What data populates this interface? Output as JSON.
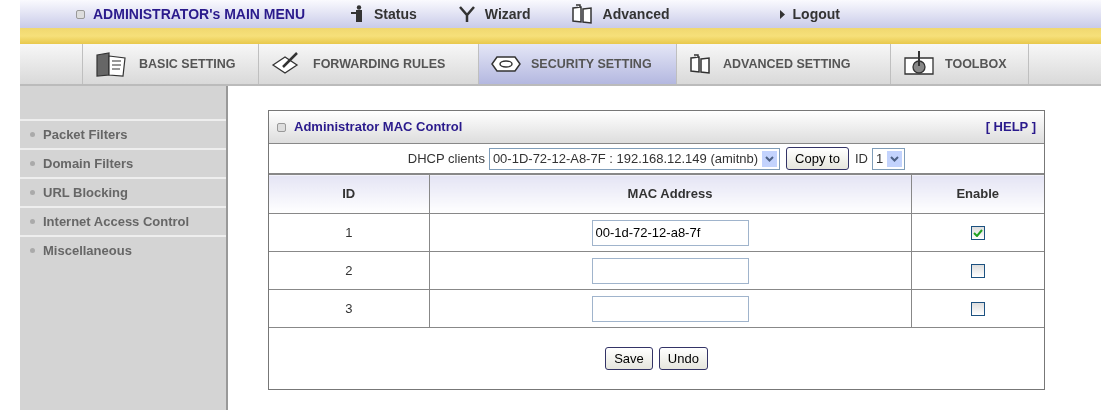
{
  "main_menu": {
    "title": "ADMINISTRATOR's MAIN MENU",
    "items": [
      {
        "label": "Status",
        "kind": "person"
      },
      {
        "label": "Wizard",
        "kind": "wand"
      },
      {
        "label": "Advanced",
        "kind": "book"
      },
      {
        "label": "Logout",
        "kind": "arrow"
      }
    ]
  },
  "tabs": [
    {
      "label": "BASIC SETTING",
      "kind": "folder",
      "selected": false
    },
    {
      "label": "FORWARDING RULES",
      "kind": "pen",
      "selected": false
    },
    {
      "label": "SECURITY SETTING",
      "kind": "nut",
      "selected": true
    },
    {
      "label": "ADVANCED SETTING",
      "kind": "book",
      "selected": false
    },
    {
      "label": "TOOLBOX",
      "kind": "gear",
      "selected": false
    }
  ],
  "sidebar": {
    "items": [
      "Packet Filters",
      "Domain Filters",
      "URL Blocking",
      "Internet Access Control",
      "Miscellaneous"
    ]
  },
  "panel": {
    "title": "Administrator MAC Control",
    "help": "[ HELP ]",
    "dhcp": {
      "label": "DHCP clients",
      "value": "00-1D-72-12-A8-7F : 192.168.12.149 (amitnb)",
      "copy_button": "Copy to",
      "id_label": "ID",
      "id_value": "1"
    },
    "columns": [
      "ID",
      "MAC Address",
      "Enable"
    ],
    "rows": [
      {
        "id": "1",
        "mac": "00-1d-72-12-a8-7f",
        "checked": true
      },
      {
        "id": "2",
        "checked": false
      },
      {
        "id": "3",
        "checked": false
      }
    ],
    "buttons": [
      "Save",
      "Undo"
    ]
  }
}
